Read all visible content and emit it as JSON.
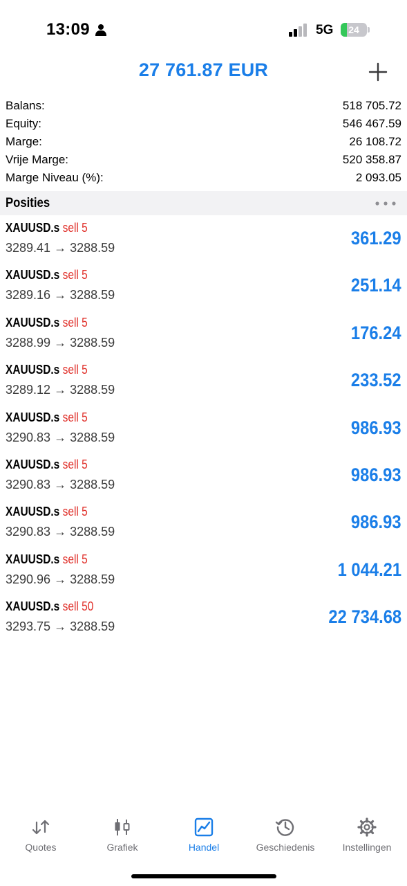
{
  "status_bar": {
    "time": "13:09",
    "network": "5G",
    "battery_level": "24",
    "battery_fraction": 0.24,
    "icons": [
      "person-icon",
      "signal-icon",
      "battery-charging-icon"
    ]
  },
  "header": {
    "title": "27 761.87 EUR",
    "add_icon": "plus-icon"
  },
  "summary": [
    {
      "label": "Balans:",
      "value": "518 705.72"
    },
    {
      "label": "Equity:",
      "value": "546 467.59"
    },
    {
      "label": "Marge:",
      "value": "26 108.72"
    },
    {
      "label": "Vrije Marge:",
      "value": "520 358.87"
    },
    {
      "label": "Marge Niveau (%):",
      "value": "2 093.05"
    }
  ],
  "positions_header": {
    "title": "Posities",
    "more_icon": "more-horizontal-icon"
  },
  "positions": [
    {
      "symbol": "XAUUSD.s",
      "side": "sell 5",
      "prices": "3289.41 → 3288.59",
      "profit": "361.29"
    },
    {
      "symbol": "XAUUSD.s",
      "side": "sell 5",
      "prices": "3289.16 → 3288.59",
      "profit": "251.14"
    },
    {
      "symbol": "XAUUSD.s",
      "side": "sell 5",
      "prices": "3288.99 → 3288.59",
      "profit": "176.24"
    },
    {
      "symbol": "XAUUSD.s",
      "side": "sell 5",
      "prices": "3289.12 → 3288.59",
      "profit": "233.52"
    },
    {
      "symbol": "XAUUSD.s",
      "side": "sell 5",
      "prices": "3290.83 → 3288.59",
      "profit": "986.93"
    },
    {
      "symbol": "XAUUSD.s",
      "side": "sell 5",
      "prices": "3290.83 → 3288.59",
      "profit": "986.93"
    },
    {
      "symbol": "XAUUSD.s",
      "side": "sell 5",
      "prices": "3290.83 → 3288.59",
      "profit": "986.93"
    },
    {
      "symbol": "XAUUSD.s",
      "side": "sell 5",
      "prices": "3290.96 → 3288.59",
      "profit": "1 044.21"
    },
    {
      "symbol": "XAUUSD.s",
      "side": "sell 50",
      "prices": "3293.75 → 3288.59",
      "profit": "22 734.68"
    }
  ],
  "tabs": [
    {
      "label": "Quotes",
      "icon": "quotes-arrows-icon",
      "active": false
    },
    {
      "label": "Grafiek",
      "icon": "candlestick-chart-icon",
      "active": false
    },
    {
      "label": "Handel",
      "icon": "trade-chart-icon",
      "active": true
    },
    {
      "label": "Geschiedenis",
      "icon": "history-clock-icon",
      "active": false
    },
    {
      "label": "Instellingen",
      "icon": "gear-icon",
      "active": false
    }
  ],
  "colors": {
    "accent": "#1a7ee8",
    "sell": "#e0302a",
    "battery": "#34c759"
  }
}
